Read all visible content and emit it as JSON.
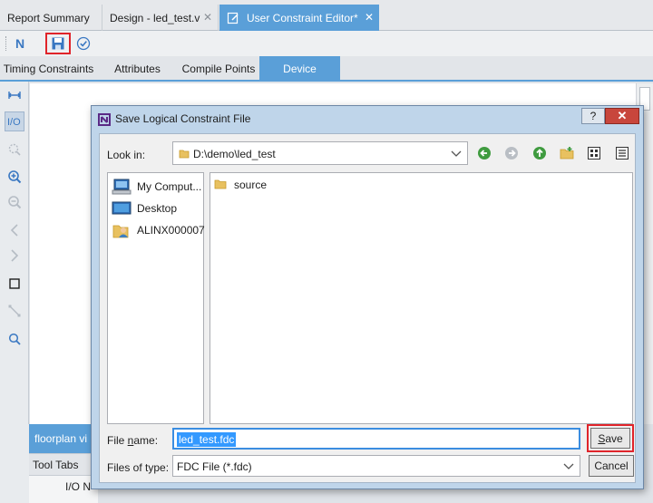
{
  "doc_tabs": {
    "report_summary": "Report Summary",
    "design": "Design - led_test.v",
    "editor": "User Constraint Editor*",
    "close_glyph": "✕"
  },
  "toolbar": {
    "new_label": "N",
    "icons": [
      "new-icon",
      "save-icon",
      "check-icon"
    ]
  },
  "view_tabs": [
    "Timing Constraints",
    "Attributes",
    "Compile Points",
    "Device"
  ],
  "left_tools": [
    "io-icon",
    "zoom-in-icon",
    "zoom-out-icon"
  ],
  "bottom": {
    "floorplan_label": "floorplan vi",
    "tool_tabs_label": "Tool Tabs",
    "io_header": "I/O N"
  },
  "dialog": {
    "title": "Save Logical Constraint File",
    "help_glyph": "?",
    "close_glyph": "✕",
    "look_in_label": "Look in:",
    "look_in_value": "D:\\demo\\led_test",
    "places": [
      "My Comput...",
      "Desktop",
      "ALINX000007"
    ],
    "files": [
      "source"
    ],
    "file_name_label_pre": "File ",
    "file_name_label_ul": "n",
    "file_name_label_post": "ame:",
    "file_name_value": "led_test.fdc",
    "file_type_label": "Files of type:",
    "file_type_value": "FDC File (*.fdc)",
    "save_ul": "S",
    "save_rest": "ave",
    "cancel_label": "Cancel"
  },
  "colors": {
    "accent": "#5a9fd8",
    "highlight_red": "#e0242a",
    "dialog_frame": "#bfd5ea"
  }
}
